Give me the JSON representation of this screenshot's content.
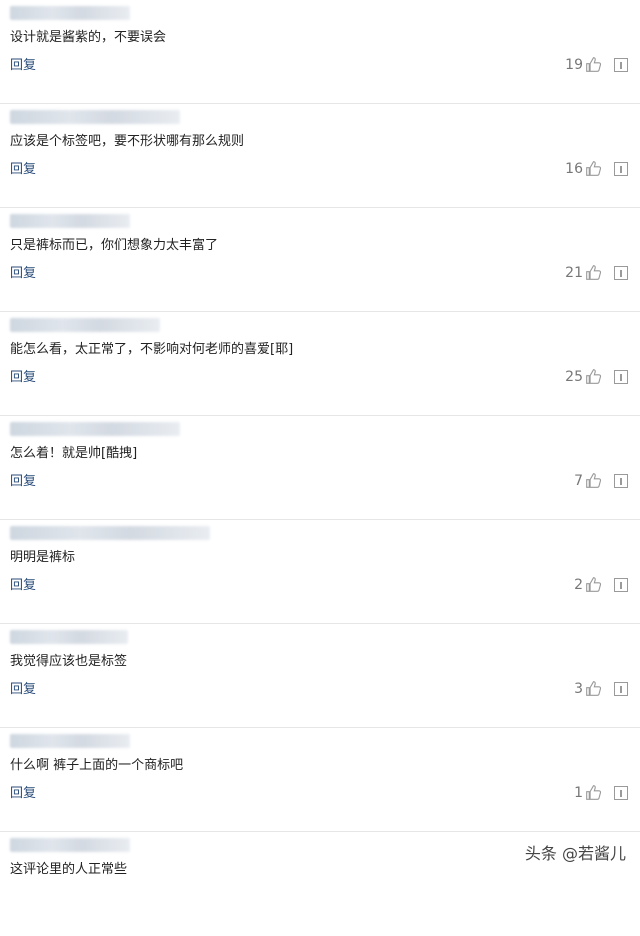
{
  "reply_label": "回复",
  "comments": [
    {
      "text": "设计就是酱紫的，不要误会",
      "likes": "19"
    },
    {
      "text": "应该是个标签吧，要不形状哪有那么规则",
      "likes": "16"
    },
    {
      "text": "只是裤标而已，你们想象力太丰富了",
      "likes": "21"
    },
    {
      "text": "能怎么看，太正常了，不影响对何老师的喜爱[耶]",
      "likes": "25"
    },
    {
      "text": "怎么着！就是帅[酷拽]",
      "likes": "7"
    },
    {
      "text": "明明是裤标",
      "likes": "2"
    },
    {
      "text": "我觉得应该也是标签",
      "likes": "3"
    },
    {
      "text": "什么啊 裤子上面的一个商标吧",
      "likes": "1"
    },
    {
      "text": "这评论里的人正常些",
      "likes": ""
    }
  ],
  "watermark": "头条 @若酱儿",
  "icons": {
    "like": "thumbs-up-icon",
    "report": "report-icon"
  }
}
